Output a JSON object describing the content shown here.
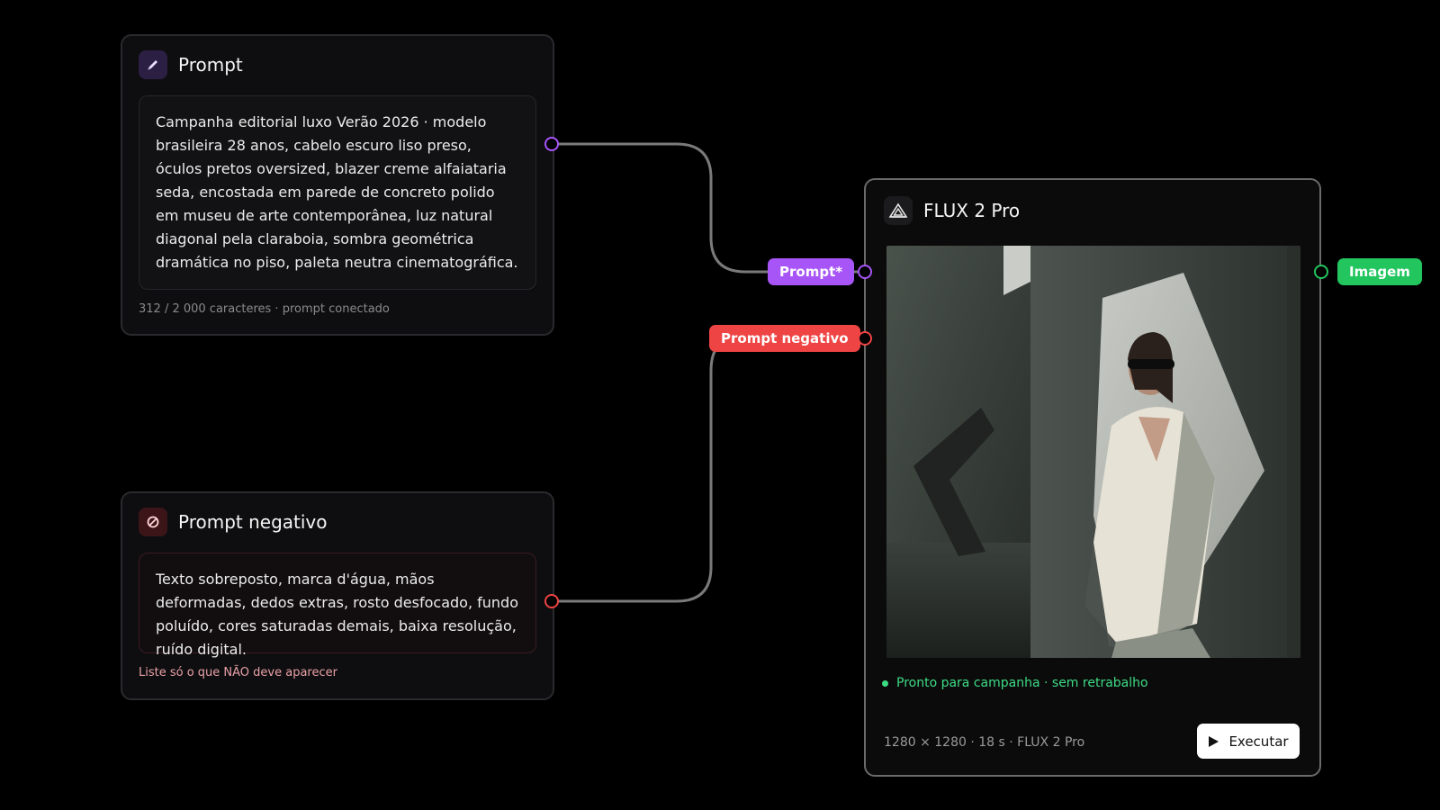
{
  "prompt_node": {
    "title": "Prompt",
    "icon": "pencil-icon",
    "text": "Campanha editorial luxo Verão 2026 · modelo brasileira 28 anos, cabelo escuro liso preso, óculos pretos oversized, blazer creme alfaiataria seda, encostada em parede de concreto polido em museu de arte contemporânea, luz natural diagonal pela claraboia, sombra geométrica dramática no piso, paleta neutra cinematográfica.",
    "caption": "312 / 2 000 caracteres · prompt conectado"
  },
  "negative_node": {
    "title": "Prompt negativo",
    "icon": "forbidden-icon",
    "text": "Texto sobreposto, marca d'água, mãos deformadas, dedos extras, rosto desfocado, fundo poluído, cores saturadas demais, baixa resolução, ruído digital.",
    "caption": "Liste só o que NÃO deve aparecer"
  },
  "flux_node": {
    "title": "FLUX 2 Pro",
    "icon": "flux-logo-icon",
    "input_prompt_label": "Prompt*",
    "input_negative_label": "Prompt negativo",
    "output_label": "Imagem",
    "status": "Pronto para campanha · sem retrabalho",
    "meta": "1280 × 1280 · 18 s · FLUX 2 Pro",
    "run_label": "Executar"
  },
  "colors": {
    "prompt_accent": "#a855f7",
    "negative_accent": "#ef4444",
    "output_accent": "#22c55e",
    "wire": "#6b6b6b"
  }
}
